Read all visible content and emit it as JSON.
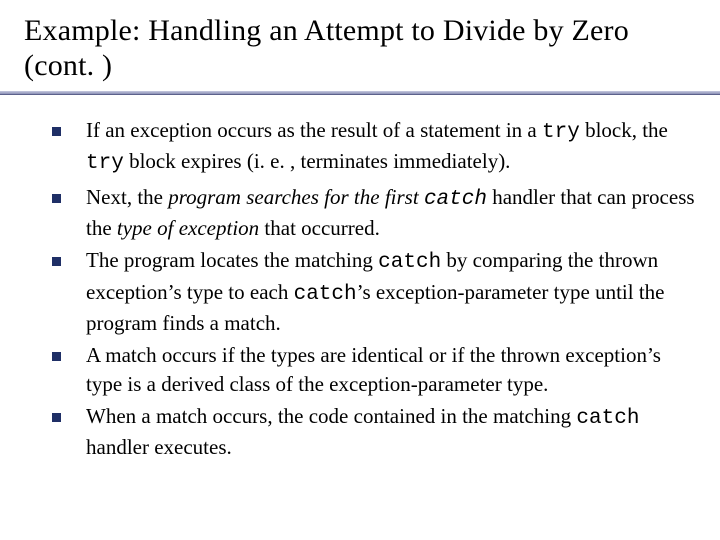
{
  "title": "Example: Handling an Attempt to Divide by Zero (cont. )",
  "bullets": [
    {
      "segments": [
        {
          "t": "If an exception occurs as the result of a statement in a "
        },
        {
          "t": "try",
          "cls": "mono"
        },
        {
          "t": " block, the "
        },
        {
          "t": "try",
          "cls": "mono"
        },
        {
          "t": " block expires (i. e. , terminates immediately)."
        }
      ]
    },
    {
      "segments": [
        {
          "t": "Next, the "
        },
        {
          "t": "program searches for the first ",
          "cls": "ital"
        },
        {
          "t": "catch",
          "cls": "mono ital"
        },
        {
          "t": " handler that can process the "
        },
        {
          "t": "type of exception",
          "cls": "ital"
        },
        {
          "t": " that occurred."
        }
      ]
    },
    {
      "segments": [
        {
          "t": "The program locates the matching "
        },
        {
          "t": "catch",
          "cls": "mono"
        },
        {
          "t": " by comparing the thrown exception’s type to each "
        },
        {
          "t": "catch",
          "cls": "mono"
        },
        {
          "t": "’s exception-parameter type until the program finds a match."
        }
      ]
    },
    {
      "segments": [
        {
          "t": "A match occurs if the types are identical or if the thrown exception’s type is a derived class of the exception-parameter type."
        }
      ]
    },
    {
      "segments": [
        {
          "t": "When a match occurs, the code contained in the matching "
        },
        {
          "t": "catch",
          "cls": "mono"
        },
        {
          "t": " handler executes."
        }
      ]
    }
  ]
}
